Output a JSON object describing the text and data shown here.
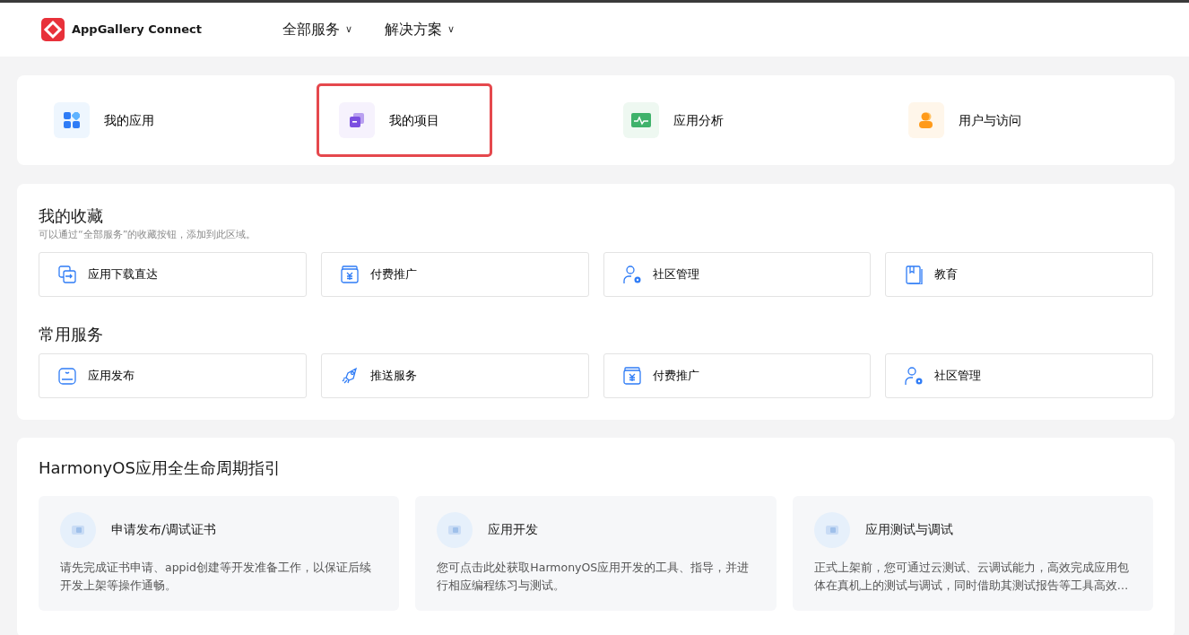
{
  "header": {
    "brand": "AppGallery Connect",
    "menus": [
      {
        "label": "全部服务",
        "caret": "∨"
      },
      {
        "label": "解决方案",
        "caret": "∨"
      }
    ]
  },
  "quick_links": [
    {
      "label": "我的应用",
      "kind": "apps",
      "highlighted": false
    },
    {
      "label": "我的项目",
      "kind": "project",
      "highlighted": true
    },
    {
      "label": "应用分析",
      "kind": "analytics",
      "highlighted": false
    },
    {
      "label": "用户与访问",
      "kind": "user",
      "highlighted": false
    }
  ],
  "favorites": {
    "title": "我的收藏",
    "hint": "可以通过“全部服务”的收藏按钮，添加到此区域。",
    "items": [
      {
        "label": "应用下载直达",
        "kind": "download"
      },
      {
        "label": "付费推广",
        "kind": "payment"
      },
      {
        "label": "社区管理",
        "kind": "community"
      },
      {
        "label": "教育",
        "kind": "education"
      }
    ]
  },
  "common_services": {
    "title": "常用服务",
    "items": [
      {
        "label": "应用发布",
        "kind": "publish"
      },
      {
        "label": "推送服务",
        "kind": "push"
      },
      {
        "label": "付费推广",
        "kind": "payment"
      },
      {
        "label": "社区管理",
        "kind": "community"
      }
    ]
  },
  "lifecycle": {
    "title": "HarmonyOS应用全生命周期指引",
    "cards": [
      {
        "title": "申请发布/调试证书",
        "description": "请先完成证书申请、appid创建等开发准备工作，以保证后续开发上架等操作通畅。"
      },
      {
        "title": "应用开发",
        "description": "您可点击此处获取HarmonyOS应用开发的工具、指导，并进行相应编程练习与测试。"
      },
      {
        "title": "应用测试与调试",
        "description": "正式上架前，您可通过云测试、云调试能力，高效完成应用包体在真机上的测试与调试，同时借助其测试报告等工具高效…"
      }
    ]
  }
}
